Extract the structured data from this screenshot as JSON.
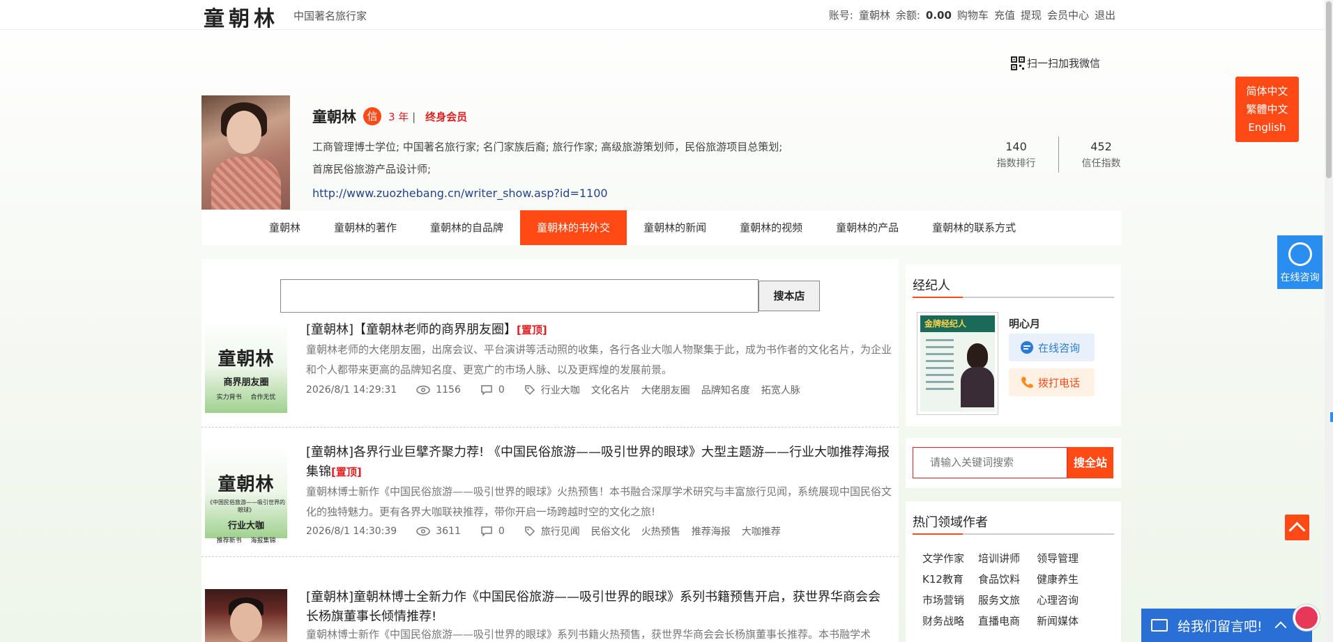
{
  "topbar": {
    "logo": "童朝林",
    "slogan": "中国著名旅行家",
    "account_label": "账号:",
    "account_name": "童朝林",
    "balance_label": "余额:",
    "balance_value": "0.00",
    "links": [
      "购物车",
      "充值",
      "提现",
      "会员中心",
      "退出"
    ]
  },
  "wechat_scan": "扫一扫加我微信",
  "languages": [
    "简体中文",
    "繁體中文",
    "English"
  ],
  "profile": {
    "name": "童朝林",
    "credit_badge": "信",
    "years": "3 年",
    "years_sep": "|",
    "membership": "终身会员",
    "bio_line1": "工商管理博士学位; 中国著名旅行家; 名门家族后裔; 旅行作家; 高级旅游策划师，民俗旅游项目总策划;",
    "bio_line2": "首席民俗旅游产品设计师;",
    "url": "http://www.zuozhebang.cn/writer_show.asp?id=1100",
    "stats": [
      {
        "value": "140",
        "label": "指数排行"
      },
      {
        "value": "452",
        "label": "信任指数"
      }
    ]
  },
  "nav": {
    "items": [
      "童朝林",
      "童朝林的著作",
      "童朝林的自品牌",
      "童朝林的书外交",
      "童朝林的新闻",
      "童朝林的视频",
      "童朝林的产品",
      "童朝林的联系方式"
    ],
    "active": "童朝林的书外交"
  },
  "store_search": {
    "placeholder": "",
    "button": "搜本店"
  },
  "articles": [
    {
      "title": "[童朝林]【童朝林老师的商界朋友圈】",
      "top_tag": "[置顶]",
      "desc": "童朝林老师的大佬朋友圈，出席会议、平台演讲等活动照的收集，各行各业大咖人物聚集于此，成为书作者的文化名片，为企业和个人都带来更高的品牌知名度、更宽广的市场人脉、以及更辉煌的发展前景。",
      "date": "2026/8/1 14:29:31",
      "views": "1156",
      "comments": "0",
      "tags": [
        "行业大咖",
        "文化名片",
        "大佬朋友圈",
        "品牌知名度",
        "拓宽人脉"
      ],
      "thumb": {
        "title": "童朝林",
        "subtitle": "商界朋友圈",
        "caption": "实力背书 合作无忧"
      }
    },
    {
      "title": "[童朝林]各界行业巨擘齐聚力荐! 《中国民俗旅游——吸引世界的眼球》大型主题游——行业大咖推荐海报集锦",
      "top_tag": "[置顶]",
      "desc": "童朝林博士新作《中国民俗旅游——吸引世界的眼球》火热预售！本书融合深厚学术研究与丰富旅行见闻，系统展现中国民俗文化的独特魅力。更有各界大咖联袂推荐，带你开启一场跨越时空的文化之旅!",
      "date": "2026/8/1 14:30:39",
      "views": "3611",
      "comments": "0",
      "tags": [
        "旅行见闻",
        "民俗文化",
        "火热预售",
        "推荐海报",
        "大咖推荐"
      ],
      "thumb": {
        "title": "童朝林",
        "subtitle": "《中国民俗旅游——吸引世界的眼球》",
        "subtitle2": "行业大咖",
        "caption": "推荐新书 海报集锦"
      }
    },
    {
      "title": "[童朝林]童朝林博士全新力作《中国民俗旅游——吸引世界的眼球》系列书籍预售开启，获世界华商会会长杨旗董事长倾情推荐!",
      "desc": "童朝林博士新作《中国民俗旅游——吸引世界的眼球》系列书籍火热预售，获世界华商会会长杨旗董事长推荐。本书融学术"
    }
  ],
  "sidebar": {
    "agent_title": "经纪人",
    "agent_name": "明心月",
    "agent_card_text": "金牌经纪人",
    "consult_button": "在线咨询",
    "call_button": "拨打电话",
    "site_search_placeholder": "请输入关键词搜索",
    "site_search_button": "搜全站",
    "hot_title": "热门领域作者",
    "hot_fields": [
      "文学作家",
      "培训讲师",
      "领导管理",
      "K12教育",
      "食品饮料",
      "健康养生",
      "市场营销",
      "服务文旅",
      "心理咨询",
      "财务战略",
      "直播电商",
      "新闻媒体"
    ]
  },
  "float": {
    "consult": "在线咨询",
    "message_bar": "给我们留言吧!"
  },
  "colors": {
    "accent": "#ff4a16",
    "link": "#23448a",
    "consult_blue": "#2a8ef0"
  }
}
